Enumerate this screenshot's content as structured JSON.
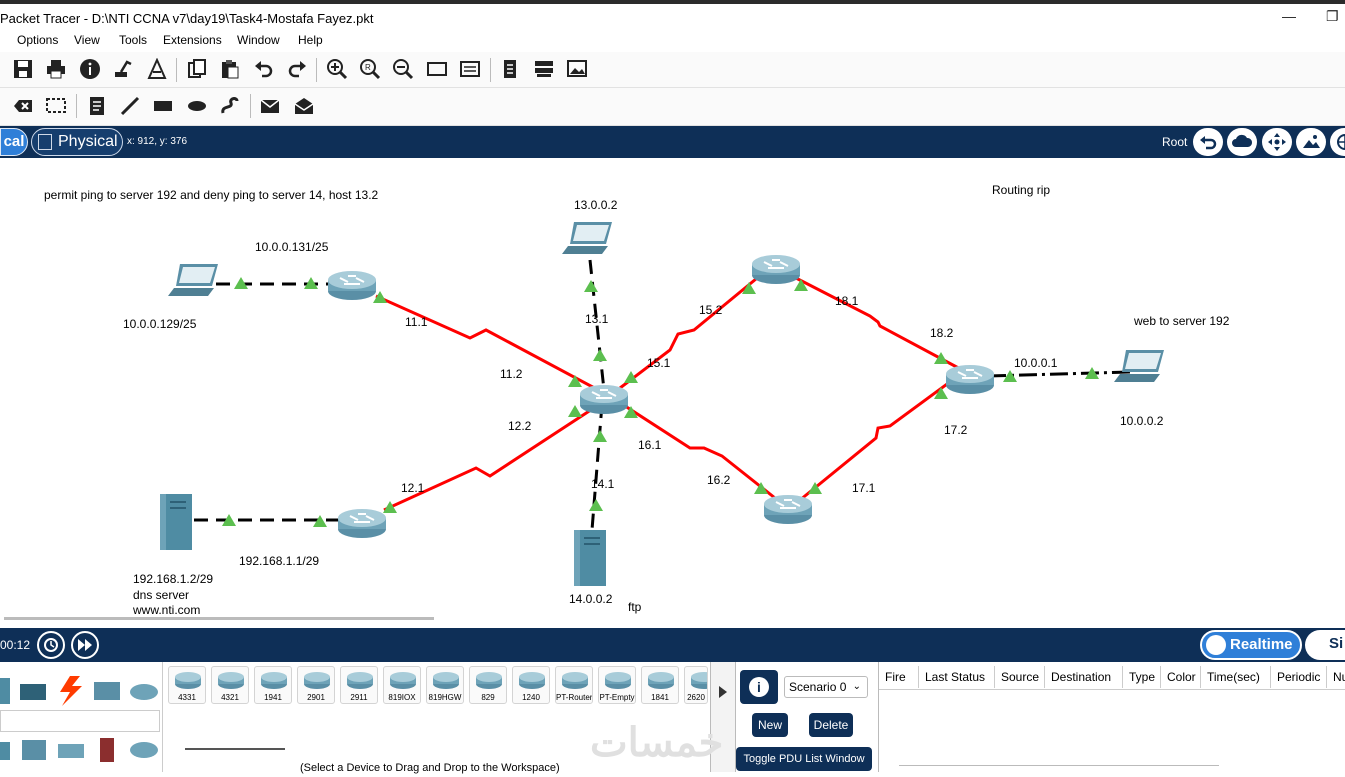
{
  "window": {
    "title": "Packet Tracer - D:\\NTI CCNA v7\\day19\\Task4-Mostafa Fayez.pkt",
    "controls": [
      "—",
      "❐"
    ]
  },
  "menu": [
    "Options",
    "View",
    "Tools",
    "Extensions",
    "Window",
    "Help"
  ],
  "toolbar1_icons": [
    "save-icon",
    "print-icon",
    "info-icon",
    "network-wizard-icon",
    "custom-device-icon",
    "copy-icon",
    "paste-icon",
    "undo-icon",
    "redo-icon",
    "zoom-in-icon",
    "zoom-reset-icon",
    "zoom-out-icon",
    "drawing-palette-icon",
    "custom-device-dialog-icon",
    "text-file-icon",
    "ipc-icon",
    "image-icon"
  ],
  "toolbar2_icons": [
    "delete-icon",
    "select-icon",
    "note-icon",
    "line-icon",
    "rectangle-icon",
    "ellipse-icon",
    "freeform-icon",
    "add-simple-pdu-icon",
    "add-complex-pdu-icon"
  ],
  "navbar": {
    "logical_tab": "cal",
    "physical_tab": "Physical",
    "coords": "x: 912, y: 376",
    "root_label": "Root"
  },
  "topology": {
    "notes": [
      "permit ping to server 192 and deny ping to server 14, host 13.2",
      "Routing rip",
      "web to server 192"
    ],
    "labels": {
      "l_10_0_0_131": "10.0.0.131/25",
      "l_10_0_0_129": "10.0.0.129/25",
      "l_11_1": "11.1",
      "l_11_2": "11.2",
      "l_12_1": "12.1",
      "l_12_2": "12.2",
      "l_13_0_0_2": "13.0.0.2",
      "l_13_1": "13.1",
      "l_14_1": "14.1",
      "l_14_0_0_2": "14.0.0.2",
      "l_15_1": "15.1",
      "l_15_2": "15.2",
      "l_16_1": "16.1",
      "l_16_2": "16.2",
      "l_17_1": "17.1",
      "l_17_2": "17.2",
      "l_18_1": "18.1",
      "l_18_2": "18.2",
      "l_10_0_0_1": "10.0.0.1",
      "l_10_0_0_2": "10.0.0.2",
      "l_192_168_1_1": "192.168.1.1/29",
      "l_192_168_1_2": "192.168.1.2/29",
      "l_dns": "dns server",
      "l_www": "www.nti.com",
      "l_ftp": "ftp"
    }
  },
  "bottombar": {
    "timer": "00:12",
    "realtime": "Realtime",
    "simulation": "Si"
  },
  "devices": [
    "4331",
    "4321",
    "1941",
    "2901",
    "2911",
    "819IOX",
    "819HGW",
    "829",
    "1240",
    "PT-Router",
    "PT-Empty",
    "1841",
    "2620"
  ],
  "device_hint": "(Select a Device to Drag and Drop to the Workspace)",
  "scenario": {
    "select": "Scenario 0",
    "new_btn": "New",
    "delete_btn": "Delete",
    "toggle_btn": "Toggle PDU List Window"
  },
  "pdu_table": {
    "headers": [
      "Fire",
      "Last Status",
      "Source",
      "Destination",
      "Type",
      "Color",
      "Time(sec)",
      "Periodic",
      "Nu"
    ]
  },
  "watermark": "خمسات",
  "colors": {
    "navy": "#0e2f57",
    "accent_blue": "#2f7fd8",
    "serial_link": "#ff0000",
    "link_up": "#4caf50"
  }
}
